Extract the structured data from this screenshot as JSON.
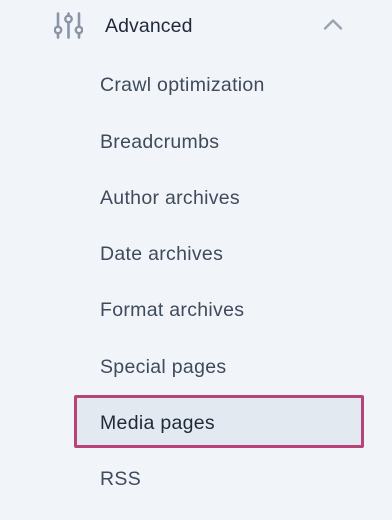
{
  "section": {
    "title": "Advanced",
    "icon": "sliders-icon",
    "toggle_icon": "chevron-up-icon",
    "expanded": true
  },
  "menu": {
    "items": [
      {
        "label": "Crawl optimization",
        "active": false
      },
      {
        "label": "Breadcrumbs",
        "active": false
      },
      {
        "label": "Author archives",
        "active": false
      },
      {
        "label": "Date archives",
        "active": false
      },
      {
        "label": "Format archives",
        "active": false
      },
      {
        "label": "Special pages",
        "active": false
      },
      {
        "label": "Media pages",
        "active": true
      },
      {
        "label": "RSS",
        "active": false
      }
    ]
  },
  "colors": {
    "background": "#f1f5fa",
    "text": "#3f4a5a",
    "icon": "#8a94a6",
    "active_border": "#b6447a",
    "active_background": "#e3e9f1"
  }
}
